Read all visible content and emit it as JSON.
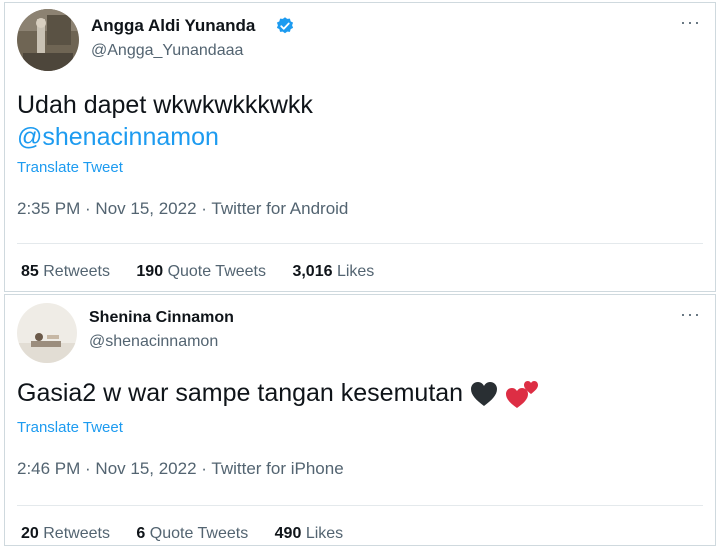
{
  "tweets": [
    {
      "display_name": "Angga Aldi Yunanda",
      "handle": "@Angga_Yunandaaa",
      "verified": true,
      "more_icon": "···",
      "text": "Udah dapet wkwkwkkkwkk",
      "mention": "@shenacinnamon",
      "translate": "Translate Tweet",
      "time": "2:35 PM",
      "date": "Nov 15, 2022",
      "source": "Twitter for Android",
      "retweets": "85",
      "retweets_label": "Retweets",
      "quote_tweets": "190",
      "quote_tweets_label": "Quote Tweets",
      "likes": "3,016",
      "likes_label": "Likes"
    },
    {
      "display_name": "Shenina Cinnamon",
      "handle": "@shenacinnamon",
      "verified": false,
      "more_icon": "···",
      "text": "Gasia2 w war sampe tangan kesemutan",
      "emojis": [
        "black-heart-icon",
        "two-hearts-icon"
      ],
      "translate": "Translate Tweet",
      "time": "2:46 PM",
      "date": "Nov 15, 2022",
      "source": "Twitter for iPhone",
      "retweets": "20",
      "retweets_label": "Retweets",
      "quote_tweets": "6",
      "quote_tweets_label": "Quote Tweets",
      "likes": "490",
      "likes_label": "Likes"
    }
  ],
  "colors": {
    "link": "#1d9bf0",
    "muted": "#536471",
    "text": "#0f1419",
    "border": "#cfd9de"
  },
  "meta_separator": " · "
}
